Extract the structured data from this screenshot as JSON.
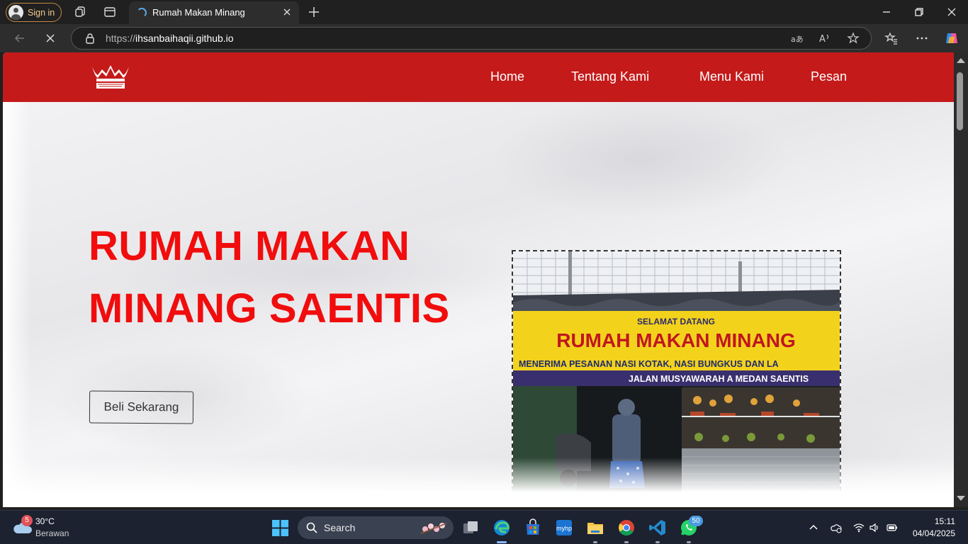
{
  "browser": {
    "signin_label": "Sign in",
    "tab_title": "Rumah Makan Minang",
    "url_protocol": "https://",
    "url_host": "ihsanbaihaqii.github.io",
    "accent_signin": "#c48a45"
  },
  "site": {
    "nav_color": "#c41a1a",
    "nav": {
      "home": "Home",
      "about": "Tentang Kami",
      "menu": "Menu Kami",
      "order": "Pesan"
    },
    "hero": {
      "title_line1": "RUMAH MAKAN",
      "title_line2": "MINANG SAENTIS",
      "title_color": "#f10d0d",
      "cta_label": "Beli Sekarang"
    },
    "photo": {
      "sign_top": "SELAMAT DATANG",
      "sign_main": "RUMAH MAKAN MINANG",
      "sign_sub": "MENERIMA PESANAN NASI KOTAK, NASI BUNGKUS DAN LA",
      "sign_address": "JALAN MUSYAWARAH A MEDAN SAENTIS"
    }
  },
  "taskbar": {
    "weather_badge": "5",
    "weather_temp": "30°C",
    "weather_desc": "Berawan",
    "search_label": "Search",
    "whatsapp_badge": "50",
    "clock_time": "15:11",
    "clock_date": "04/04/2025"
  }
}
